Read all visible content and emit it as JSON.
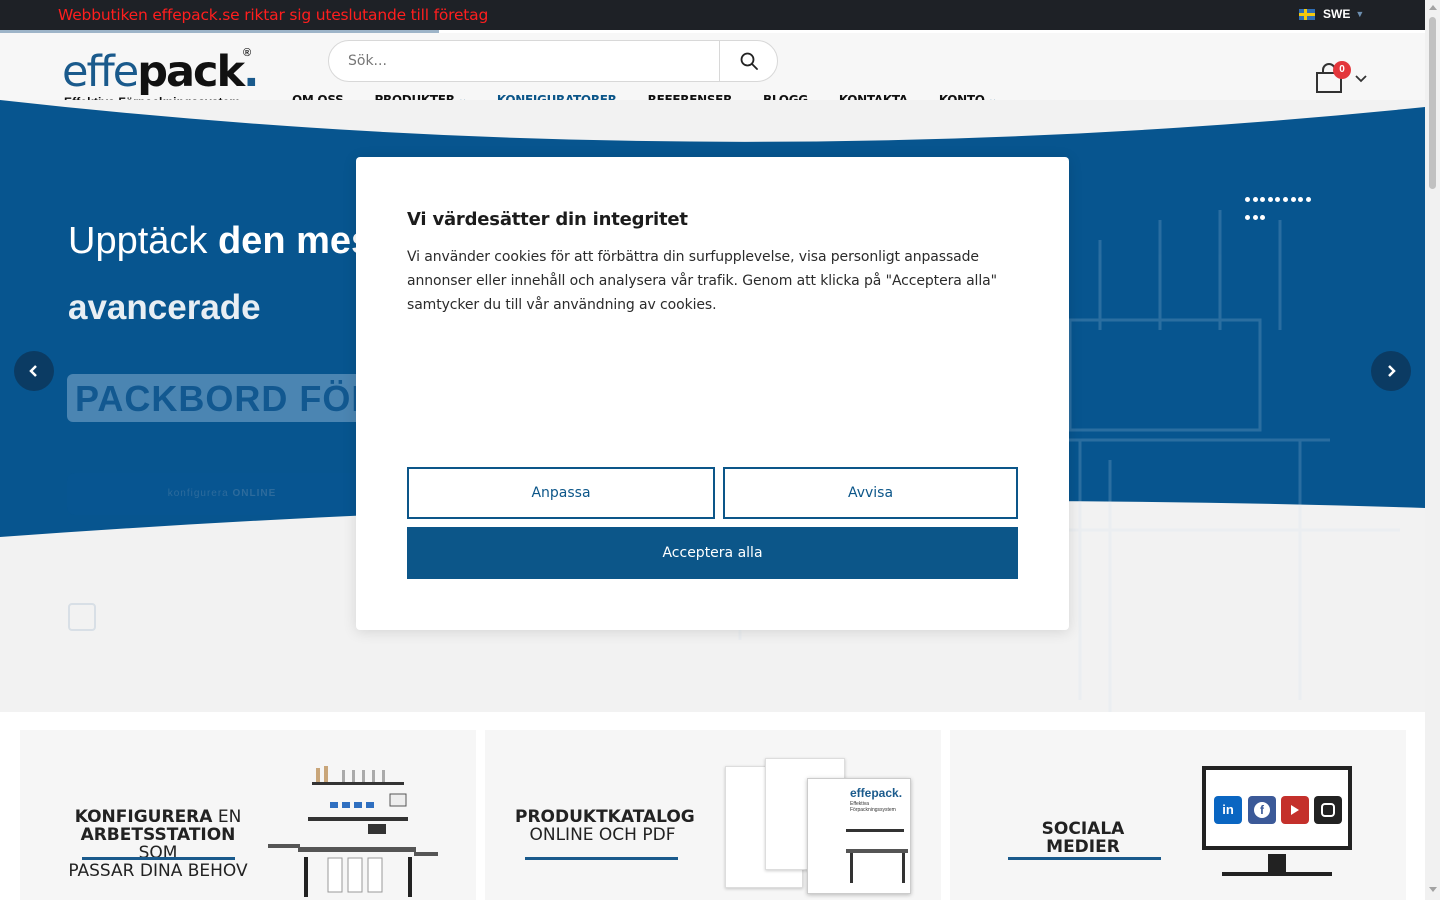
{
  "topbar": {
    "message": "Webbutiken effepack.se riktar sig uteslutande till företag",
    "language": "SWE"
  },
  "logo": {
    "brand_effe": "effe",
    "brand_pack": "pack",
    "registered": "®",
    "tagline": "Effektiva Förpackningssystem"
  },
  "search": {
    "placeholder": "Sök..."
  },
  "nav": {
    "items": [
      {
        "label": "OM OSS",
        "has_dropdown": false
      },
      {
        "label": "PRODUKTER",
        "has_dropdown": true
      },
      {
        "label": "KONFIGURATORER",
        "has_dropdown": false,
        "active": true
      },
      {
        "label": "REFERENSER",
        "has_dropdown": false
      },
      {
        "label": "BLOGG",
        "has_dropdown": false
      },
      {
        "label": "KONTAKTA",
        "has_dropdown": false
      },
      {
        "label": "KONTO",
        "has_dropdown": true
      }
    ]
  },
  "cart": {
    "count": "0",
    "icon": "shopping-bag-icon"
  },
  "hero": {
    "line1_plain": "Upptäck ",
    "line1_bold": "den mest",
    "line2": "avancerade",
    "tag": "PACKBORD FÖR E",
    "button_prefix": "konfigurera ",
    "button_bold": "ONLINE"
  },
  "modal": {
    "title": "Vi värdesätter din integritet",
    "body": "Vi använder cookies för att förbättra din surfupplevelse, visa personligt anpassade annonser eller innehåll och analysera vår trafik. Genom att klicka på \"Acceptera alla\" samtycker du till vår användning av cookies.",
    "customize_label": "Anpassa",
    "reject_label": "Avvisa",
    "accept_label": "Acceptera alla"
  },
  "cards": {
    "configure": {
      "line1_bold": "KONFIGURERA",
      "line1_rest": " EN",
      "line2_bold": "ARBETSSTATION",
      "line2_rest": " SOM",
      "line3": "PASSAR DINA BEHOV"
    },
    "catalog": {
      "line1": "PRODUKTKATALOG",
      "line2": "ONLINE OCH PDF",
      "mini_logo": "effepack.",
      "mini_tagline": "Effektiva Förpackningssystem"
    },
    "social": {
      "line1": "SOCIALA",
      "line2": "MEDIER",
      "networks": [
        "linkedin-icon",
        "facebook-icon",
        "youtube-icon",
        "instagram-icon"
      ]
    }
  },
  "colors": {
    "brand_blue": "#0c5689",
    "topbar_bg": "#1e2126",
    "alert_red": "#ff1e1e",
    "badge_red": "#e3363b",
    "hero_blue": "#07558f"
  }
}
